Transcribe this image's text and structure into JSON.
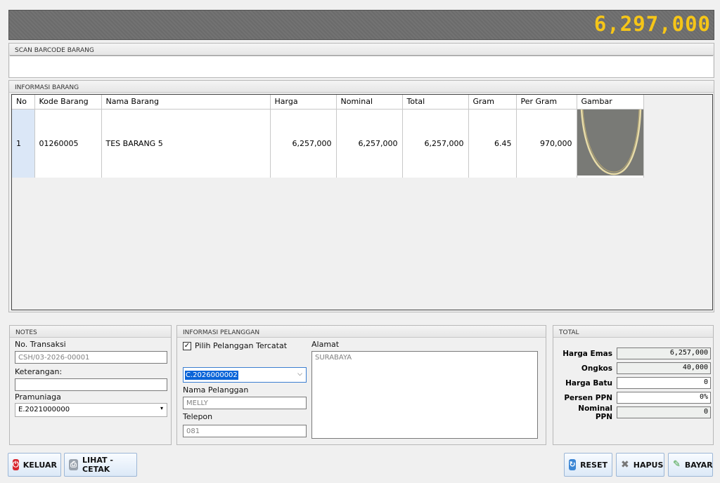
{
  "header": {
    "grand_total": "6,297,000"
  },
  "scan": {
    "title": "SCAN BARCODE BARANG",
    "value": ""
  },
  "info_barang": {
    "title": "INFORMASI BARANG",
    "columns": [
      "No",
      "Kode Barang",
      "Nama Barang",
      "Harga",
      "Nominal",
      "Total",
      "Gram",
      "Per Gram",
      "Gambar"
    ],
    "rows": [
      {
        "no": "1",
        "kode": "01260005",
        "nama": "TES BARANG 5",
        "harga": "6,257,000",
        "nominal": "6,257,000",
        "total": "6,257,000",
        "gram": "6.45",
        "per_gram": "970,000",
        "gambar": "gold-necklace-image"
      }
    ]
  },
  "notes": {
    "title": "NOTES",
    "no_transaksi_label": "No. Transaksi",
    "no_transaksi": "CSH/03-2026-00001",
    "keterangan_label": "Keterangan:",
    "keterangan": "",
    "pramuniaga_label": "Pramuniaga",
    "pramuniaga": "E.2021000000"
  },
  "pelanggan": {
    "title": "INFORMASI PELANGGAN",
    "pilih_label": "Pilih Pelanggan Tercatat",
    "pilih_checked": true,
    "kode": "C.2026000002",
    "nama_label": "Nama Pelanggan",
    "nama": "MELLY",
    "telepon_label": "Telepon",
    "telepon": "081",
    "alamat_label": "Alamat",
    "alamat": "SURABAYA"
  },
  "total": {
    "title": "TOTAL",
    "rows": [
      {
        "label": "Harga Emas",
        "value": "6,257,000"
      },
      {
        "label": "Ongkos",
        "value": "40,000"
      },
      {
        "label": "Harga Batu",
        "value": "0"
      },
      {
        "label": "Persen PPN",
        "value": "0%"
      },
      {
        "label": "Nominal PPN",
        "value": "0"
      }
    ]
  },
  "buttons": {
    "keluar": "KELUAR",
    "lihat_cetak": "LIHAT - CETAK",
    "reset": "RESET",
    "hapus": "HAPUS",
    "bayar": "BAYAR"
  },
  "colors": {
    "grand_total": "#f5c518",
    "header_bg": "#6b6b6b"
  }
}
